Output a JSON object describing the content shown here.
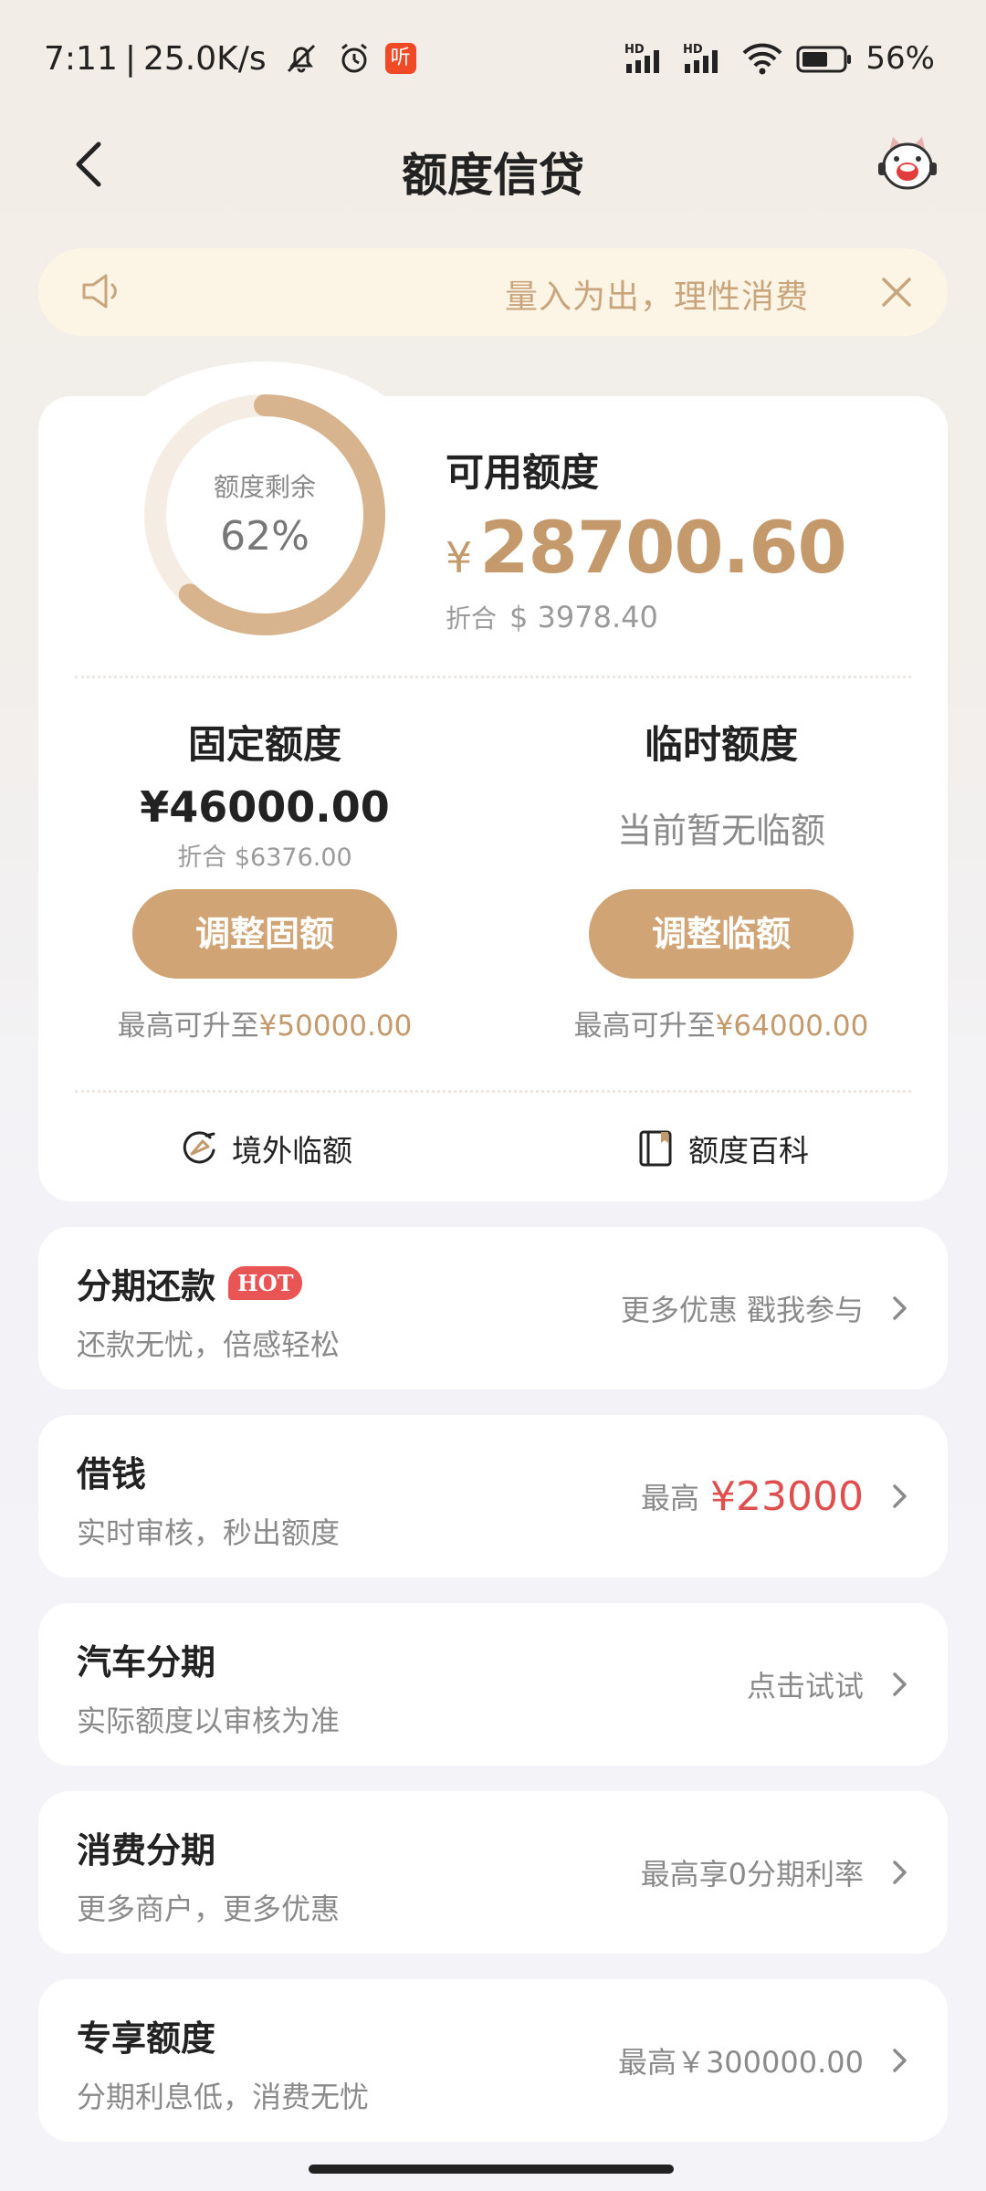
{
  "status_bar": {
    "time": "7:11",
    "separator": "|",
    "net_speed": "25.0K/s",
    "news_badge": "听",
    "signal_1": "HD",
    "signal_2": "HD",
    "battery": "56%"
  },
  "nav": {
    "title": "额度信贷"
  },
  "notice": {
    "text": "量入为出，理性消费"
  },
  "credit": {
    "ring_label": "额度剩余",
    "ring_percent_text": "62%",
    "ring_fraction": 0.62,
    "available_title": "可用额度",
    "currency": "¥",
    "available_amount": "28700.60",
    "usd_label": "折合",
    "usd_value": "$ 3978.40",
    "fixed": {
      "title": "固定额度",
      "amount": "¥46000.00",
      "usd": "折合 $6376.00",
      "button": "调整固额",
      "max_prefix": "最高可升至",
      "max_value": "¥50000.00"
    },
    "temp": {
      "title": "临时额度",
      "status": "当前暂无临额",
      "button": "调整临额",
      "max_prefix": "最高可升至",
      "max_value": "¥64000.00"
    },
    "links": {
      "overseas": "境外临额",
      "wiki": "额度百科"
    }
  },
  "services": [
    {
      "title": "分期还款",
      "badge": "HOT",
      "subtitle": "还款无忧，倍感轻松",
      "right": "更多优惠 戳我参与"
    },
    {
      "title": "借钱",
      "subtitle": "实时审核，秒出额度",
      "right_prefix": "最高",
      "right_value": "¥23000"
    },
    {
      "title": "汽车分期",
      "subtitle": "实际额度以审核为准",
      "right": "点击试试"
    },
    {
      "title": "消费分期",
      "subtitle": "更多商户，更多优惠",
      "right": "最高享0分期利率"
    },
    {
      "title": "专享额度",
      "subtitle": "分期利息低，消费无忧",
      "right": "最高￥300000.00"
    }
  ],
  "colors": {
    "accent": "#d0a474",
    "amount_gold": "#c49a6c",
    "notice_bg": "#fcf5e6",
    "red": "#e04f4f"
  }
}
